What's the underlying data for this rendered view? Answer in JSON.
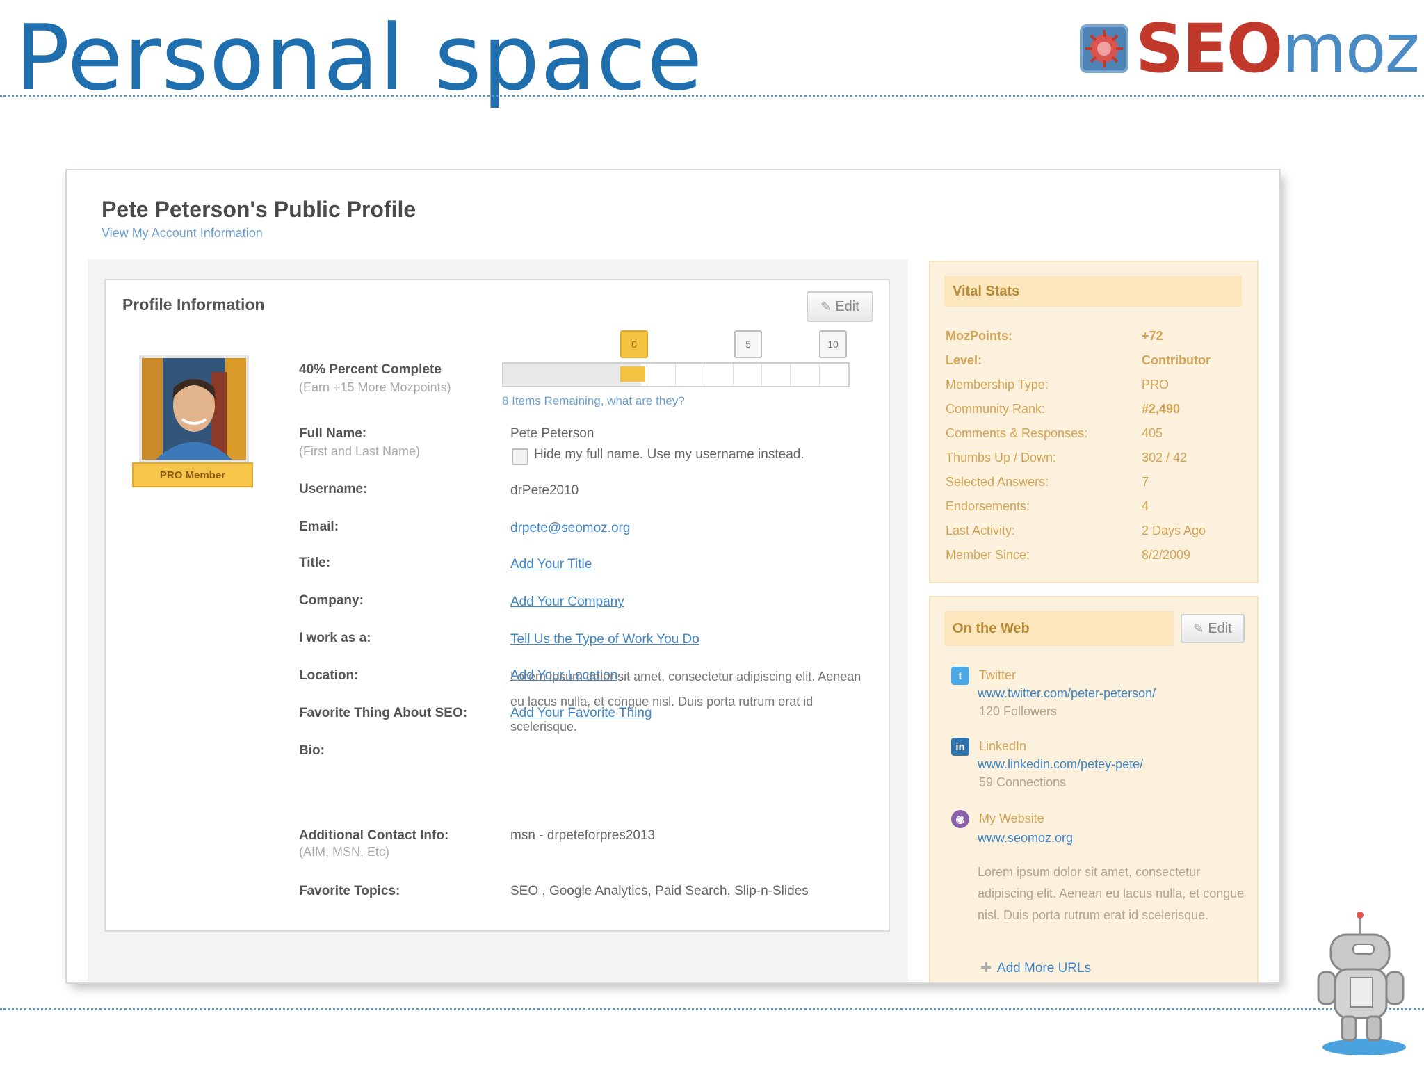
{
  "slide": {
    "title": "Personal space",
    "logo_seo": "SEO",
    "logo_moz": "moz"
  },
  "profile": {
    "heading": "Pete Peterson's Public Profile",
    "account_link": "View My Account Information"
  },
  "profile_info": {
    "title": "Profile Information",
    "edit_label": "Edit",
    "badge": "PRO Member",
    "progress": {
      "label": "40% Percent Complete",
      "sublabel": "(Earn +15 More Mozpoints)",
      "markers": [
        "0",
        "5",
        "10"
      ],
      "remaining": "8 Items Remaining, what are they?",
      "fraction": 0.4
    },
    "fields": {
      "full_name_label": "Full Name:",
      "full_name_hint": "(First and Last Name)",
      "full_name_value": "Pete Peterson",
      "hide_name": "Hide my full name. Use my username instead.",
      "username_label": "Username:",
      "username_value": "drPete2010",
      "email_label": "Email:",
      "email_value": "drpete@seomoz.org",
      "title_label": "Title:",
      "title_value": "Add Your Title",
      "company_label": "Company:",
      "company_value": "Add Your Company",
      "work_label": "I work as a:",
      "work_value": "Tell Us the Type of Work You Do",
      "location_label": "Location:",
      "location_value": "Add Your Location",
      "fav_label": "Favorite Thing About SEO:",
      "fav_value": "Add Your Favorite Thing",
      "bio_label": "Bio:",
      "bio_value": "Lorem ipsum dolor sit amet, consectetur adipiscing elit. Aenean eu lacus nulla, et congue nisl. Duis porta rutrum erat id scelerisque.",
      "contact_label": "Additional Contact Info:",
      "contact_hint": "(AIM, MSN, Etc)",
      "contact_value": "msn - drpeteforpres2013",
      "topics_label": "Favorite Topics:",
      "topics_value": "SEO , Google Analytics, Paid Search, Slip-n-Slides"
    }
  },
  "vital_stats": {
    "title": "Vital Stats",
    "rows": [
      {
        "k": "MozPoints:",
        "v": "+72"
      },
      {
        "k": "Level:",
        "v": "Contributor"
      },
      {
        "k": "Membership Type:",
        "v": "PRO"
      },
      {
        "k": "Community Rank:",
        "v": "#2,490"
      },
      {
        "k": "Comments & Responses:",
        "v": "405"
      },
      {
        "k": "Thumbs Up / Down:",
        "v": "302 / 42"
      },
      {
        "k": "Selected Answers:",
        "v": "7"
      },
      {
        "k": "Endorsements:",
        "v": "4"
      },
      {
        "k": "Last Activity:",
        "v": "2 Days Ago"
      },
      {
        "k": "Member Since:",
        "v": "8/2/2009"
      }
    ]
  },
  "on_the_web": {
    "title": "On the Web",
    "edit_label": "Edit",
    "twitter": {
      "name": "Twitter",
      "url": "www.twitter.com/peter-peterson/",
      "count": "120 Followers"
    },
    "linkedin": {
      "name": "LinkedIn",
      "url": "www.linkedin.com/petey-pete/",
      "count": "59 Connections"
    },
    "website": {
      "name": "My Website",
      "url": "www.seomoz.org",
      "desc": "Lorem ipsum dolor sit amet, consectetur adipiscing elit. Aenean eu lacus nulla, et congue nisl. Duis porta rutrum erat id scelerisque."
    },
    "add_more": "Add More URLs"
  },
  "colors": {
    "title_blue": "#1f6fae",
    "link_blue": "#3f86c9",
    "stats_gold": "#d4a456",
    "panel_cream": "#fcf1dc"
  },
  "icons": [
    "pencil-icon",
    "twitter-icon",
    "linkedin-icon",
    "website-icon",
    "plus-icon",
    "checkbox-icon",
    "robot-mascot-icon",
    "seomoz-logo-icon"
  ]
}
